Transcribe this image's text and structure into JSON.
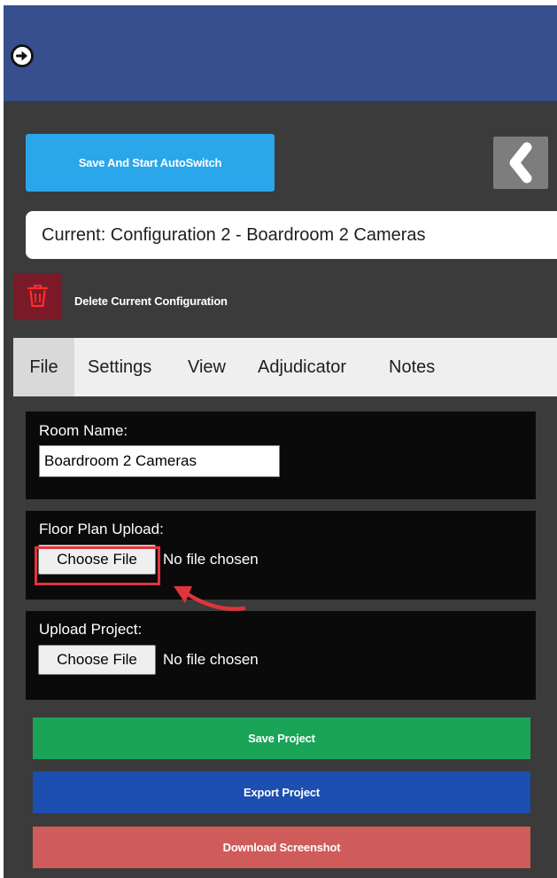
{
  "header": {
    "exit_icon": "exit-arrow-icon",
    "background_color": "#374f8c"
  },
  "toolbar": {
    "save_start_label": "Save And Start AutoSwitch",
    "save_start_color": "#2aa6ea",
    "collapse_icon": "chevron-left-icon"
  },
  "current_config": {
    "text": "Current: Configuration 2 - Boardroom 2 Cameras"
  },
  "delete_config": {
    "icon": "trash-icon",
    "label": "Delete Current Configuration",
    "color": "#7a1a28"
  },
  "tabs": [
    {
      "label": "File",
      "active": true
    },
    {
      "label": "Settings",
      "active": false
    },
    {
      "label": "View",
      "active": false
    },
    {
      "label": "Adjudicator",
      "active": false
    },
    {
      "label": "Notes",
      "active": false
    }
  ],
  "file_tab": {
    "room_name": {
      "label": "Room Name:",
      "value": "Boardroom 2 Cameras"
    },
    "floor_plan_upload": {
      "label": "Floor Plan Upload:",
      "button_label": "Choose File",
      "status": "No file chosen"
    },
    "upload_project": {
      "label": "Upload Project:",
      "button_label": "Choose File",
      "status": "No file chosen"
    }
  },
  "actions": {
    "save_project": {
      "label": "Save Project",
      "color": "#1aa458"
    },
    "export_project": {
      "label": "Export Project",
      "color": "#1c4fb0"
    },
    "download_screenshot": {
      "label": "Download Screenshot",
      "color": "#cf5b5a"
    }
  },
  "annotation": {
    "highlight_color": "#e0333c"
  }
}
